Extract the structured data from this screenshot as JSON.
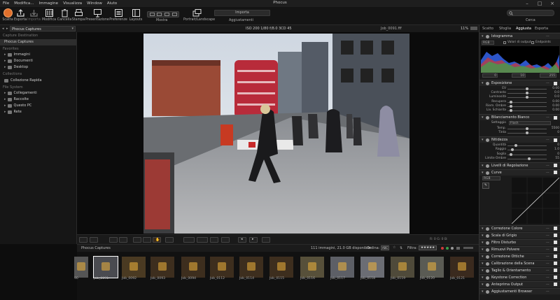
{
  "app": {
    "title": "Phocus"
  },
  "menu": [
    "File",
    "Modifica...",
    "Immagine",
    "Visualizza",
    "Window",
    "Aiuto"
  ],
  "toolbar": {
    "buttons": [
      "Scatta",
      "Esporta",
      "Importa",
      "Modifica",
      "Cancella",
      "Stampa",
      "Presentazione",
      "Preferenze",
      "Layouts"
    ],
    "mostra_label": "Mostra",
    "portrait_label": "Portrait/Landscape",
    "importa_value": "Importa",
    "aggiustamenti_label": "Aggiustamenti",
    "search_label": "Cerca",
    "search_value": ""
  },
  "pathbar": {
    "location": "Phocus Captures",
    "exif": "ISO 200   1/80   f/8.0   3CD 45",
    "filename": "Job_0091.fff",
    "zoom": "11%"
  },
  "sidebar": {
    "capture_destination": "Capture Destination",
    "capture_item": "Phocus Captures",
    "favorites": "Favorites",
    "favorites_items": [
      "Immagini",
      "Documenti",
      "Desktop"
    ],
    "collections": "Collections",
    "collections_items": [
      "Collezione Rapida"
    ],
    "file_system": "File System",
    "file_system_items": [
      "Collegamenti",
      "Raccolte",
      "Questo PC",
      "Rete"
    ]
  },
  "controls": {
    "rgb_readout": "R:   0   G:   0   B:"
  },
  "browser": {
    "title": "Phocus Captures",
    "info": "111  immagini, 21.0 GB disponibile",
    "order_label": "Ordina:",
    "order_value": "ABC",
    "filter_label": "Filtra:",
    "thumbnails": [
      "90",
      "Job_0091",
      "Job_0092",
      "Job_0093",
      "Job_0094",
      "Job_0112",
      "Job_0114",
      "Job_0115",
      "Job_0116",
      "Job_0117",
      "Job_0118",
      "Job_0119",
      "Job_0120",
      "Job_0121"
    ]
  },
  "right_panel": {
    "tabs": [
      "Scatto",
      "Sfoglia",
      "Aggiusta",
      "Esporta"
    ],
    "istogramma": {
      "title": "Istogramma",
      "mode": "RGB",
      "valori_label": "Valori di output",
      "endpoints_label": "Endpoints",
      "scale": [
        "0",
        "10",
        "255"
      ]
    },
    "esposizione": {
      "title": "Esposizione",
      "sliders": [
        {
          "name": "EV",
          "value": "0.00",
          "pos": 0.5
        },
        {
          "name": "Contrasto",
          "value": "0.0",
          "pos": 0.5
        },
        {
          "name": "Luminosità",
          "value": "0.0",
          "pos": 0.5
        },
        {
          "name": "Recupera",
          "value": "0.00",
          "pos": 0.05
        },
        {
          "name": "Riem. Ombre",
          "value": "0.00",
          "pos": 0.05
        },
        {
          "name": "Liv. Schiarita",
          "value": "0.00",
          "pos": 0.05
        }
      ]
    },
    "bilanciamento": {
      "title": "Bilanciamento Bianco",
      "preset_label": "Settaggio",
      "preset_value": "Flash",
      "sliders": [
        {
          "name": "Temp.",
          "value": "5500",
          "pos": 0.5
        },
        {
          "name": "Tinta",
          "value": "0",
          "pos": 0.5
        }
      ]
    },
    "nitidezza": {
      "title": "Nitidezza",
      "sliders": [
        {
          "name": "Quantità",
          "value": "0",
          "pos": 0.2
        },
        {
          "name": "Raggio",
          "value": "1.0",
          "pos": 0.1
        },
        {
          "name": "Soglia",
          "value": "0",
          "pos": 0.05
        },
        {
          "name": "Limite Ombre",
          "value": "55",
          "pos": 0.55
        }
      ]
    },
    "livelli": {
      "title": "Livelli di Regolazione"
    },
    "curve": {
      "title": "Curve",
      "mode": "RGB"
    },
    "tools": [
      "Correzione Colore",
      "Scala di Grigio",
      "Filtro Disturbo",
      "Rimuovi Polvere",
      "Correzione Ottiche",
      "Calibrazione della Scena",
      "Taglio & Orientamento",
      "Keystone Correction",
      "Anteprima Output",
      "Aggiustamenti Browser"
    ]
  },
  "colors": {
    "accent": "#e1702c",
    "panel": "#1b1b1b",
    "background": "#0d0d0d"
  }
}
